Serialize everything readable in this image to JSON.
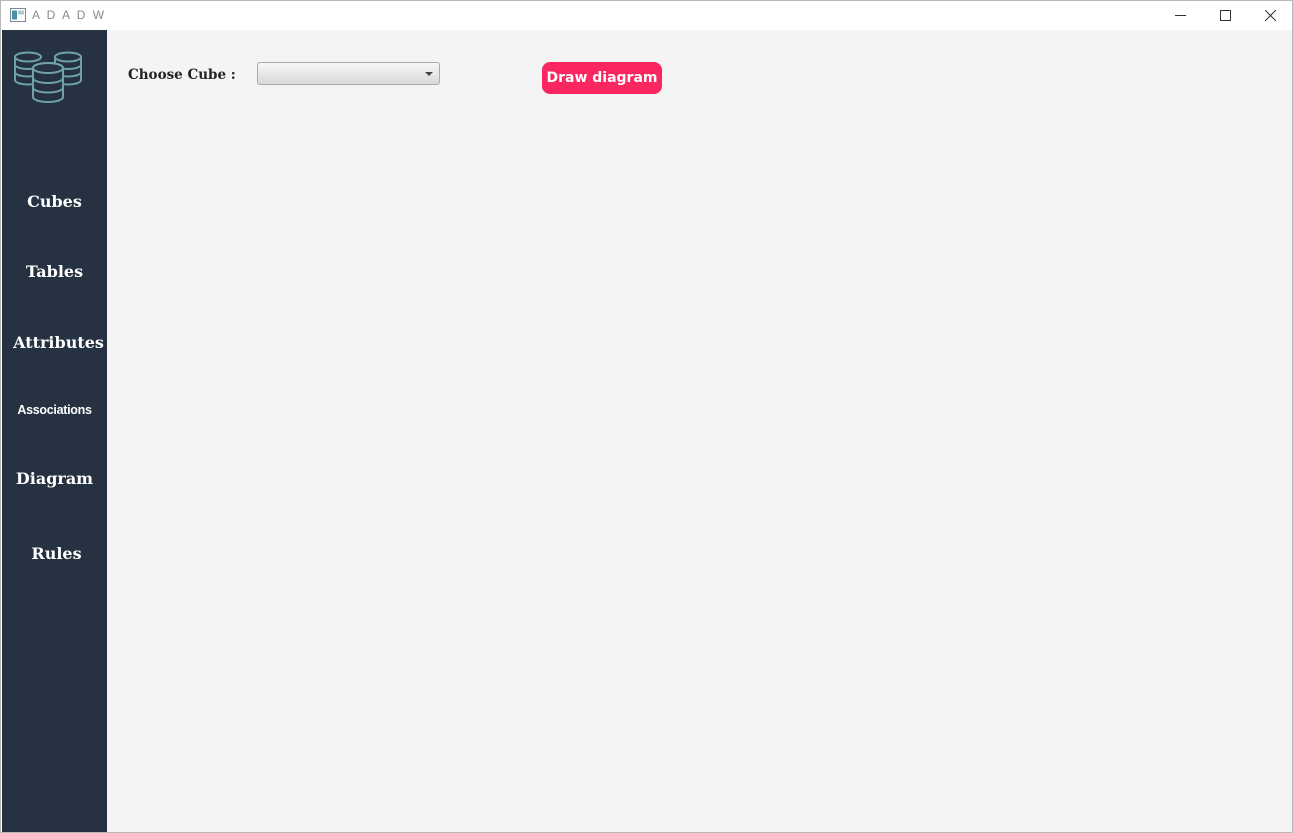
{
  "window": {
    "title": "A D A D W",
    "controls": {
      "minimize_icon": "minimize-icon",
      "maximize_icon": "maximize-icon",
      "close_icon": "close-icon"
    }
  },
  "sidebar": {
    "logo_icon": "database-stack-icon",
    "items": [
      {
        "label": "Cubes"
      },
      {
        "label": "Tables"
      },
      {
        "label": "Attributes"
      },
      {
        "label": "Associations"
      },
      {
        "label": "Diagram"
      },
      {
        "label": "Rules"
      }
    ]
  },
  "main": {
    "choose_cube_label": "Choose Cube :",
    "cube_select": {
      "value": ""
    },
    "draw_button_label": "Draw diagram"
  },
  "colors": {
    "sidebar_bg": "#263242",
    "content_bg": "#f4f4f4",
    "accent": "#fa2660",
    "logo_stroke": "#6fa3a8"
  }
}
